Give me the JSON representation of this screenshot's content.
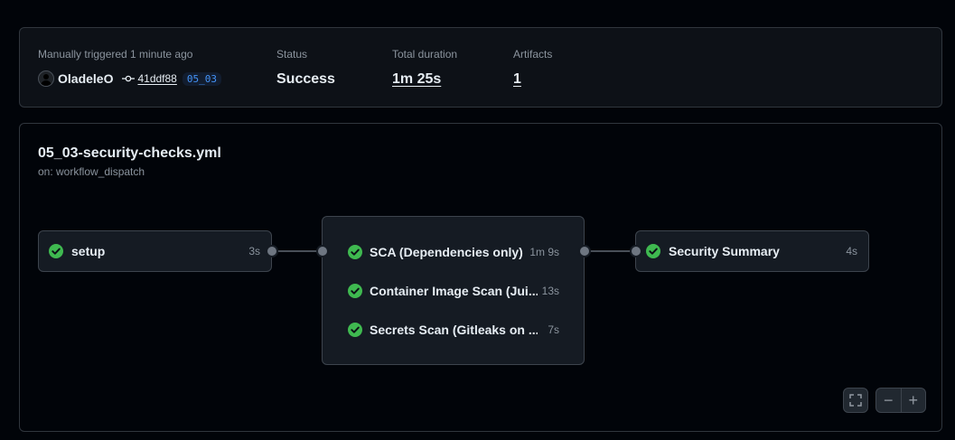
{
  "summary": {
    "trigger_label": "Manually triggered 1 minute ago",
    "user": "OladeleO",
    "commit_sha": "41ddf88",
    "branch": "05_03",
    "status_label": "Status",
    "status_value": "Success",
    "duration_label": "Total duration",
    "duration_value": "1m 25s",
    "artifacts_label": "Artifacts",
    "artifacts_value": "1"
  },
  "workflow": {
    "title": "05_03-security-checks.yml",
    "subtitle": "on: workflow_dispatch"
  },
  "jobs": {
    "setup": {
      "name": "setup",
      "duration": "3s",
      "status": "success"
    },
    "group": [
      {
        "name": "SCA (Dependencies only)",
        "duration": "1m 9s",
        "status": "success"
      },
      {
        "name": "Container Image Scan (Jui...",
        "duration": "13s",
        "status": "success"
      },
      {
        "name": "Secrets Scan (Gitleaks on ...",
        "duration": "7s",
        "status": "success"
      }
    ],
    "summary_job": {
      "name": "Security Summary",
      "duration": "4s",
      "status": "success"
    }
  },
  "controls": {
    "fullscreen_icon": "fullscreen-icon",
    "zoom_out_label": "−",
    "zoom_in_label": "+"
  },
  "colors": {
    "success": "#3fb950",
    "accent": "#4493f8"
  }
}
